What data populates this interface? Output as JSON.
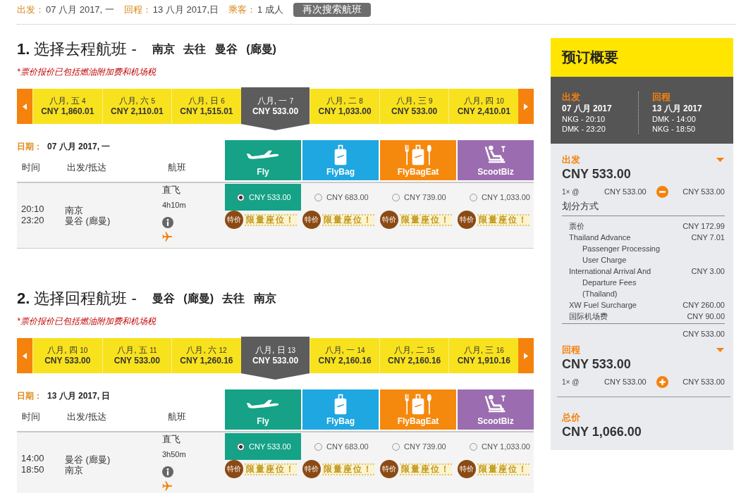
{
  "search_summary": {
    "items": [
      {
        "label": "出发：",
        "value": "07 八月 2017, 一"
      },
      {
        "label": "回程：",
        "value": "13 八月 2017,日"
      },
      {
        "label": "乘客：",
        "value": "1 成人"
      }
    ],
    "button": "再次搜索航班"
  },
  "sections": [
    {
      "title": "**1.** 选择去程航班 -",
      "route": "南京 去往 曼谷 (廊曼)",
      "note": "*票价报价已包括燃油附加费和机场税",
      "date_strip": [
        {
          "label": "八月, 五",
          "day": "4",
          "price": "CNY 1,860.01",
          "selected": false
        },
        {
          "label": "八月, 六",
          "day": "5",
          "price": "CNY 2,110.01",
          "selected": false
        },
        {
          "label": "八月, 日",
          "day": "6",
          "price": "CNY 1,515.01",
          "selected": false
        },
        {
          "label": "八月, 一",
          "day": "7",
          "price": "CNY 533.00",
          "selected": true
        },
        {
          "label": "八月, 二",
          "day": "8",
          "price": "CNY 1,033.00",
          "selected": false
        },
        {
          "label": "八月, 三",
          "day": "9",
          "price": "CNY 533.00",
          "selected": false
        },
        {
          "label": "八月, 四",
          "day": "10",
          "price": "CNY 2,410.01",
          "selected": false
        }
      ],
      "date_label": "日期：",
      "date_value": "07 八月 2017, 一",
      "columns": [
        "时间",
        "出发/抵达",
        "航班"
      ],
      "fare_types": [
        {
          "kind": "fly",
          "name": "Fly",
          "color": "#15a287"
        },
        {
          "kind": "flybag",
          "name": "FlyBag",
          "color": "#1ea7e1"
        },
        {
          "kind": "flybageat",
          "name": "FlyBagEat",
          "color": "#f5890d"
        },
        {
          "kind": "scootbiz",
          "name": "ScootBiz",
          "color": "#9b6db0"
        }
      ],
      "flights": [
        {
          "departure_time": "20:10",
          "arrival_time": "23:20",
          "origin": "南京",
          "destination": "曼谷 (廊曼)",
          "stops": "直飞",
          "duration": "4h10m",
          "fares": [
            {
              "price": "CNY 533.00",
              "selected": true,
              "badge": "特价",
              "tag": "限量座位！"
            },
            {
              "price": "CNY 683.00",
              "selected": false,
              "badge": "特价",
              "tag": "限量座位！"
            },
            {
              "price": "CNY 739.00",
              "selected": false,
              "badge": "特价",
              "tag": "限量座位！"
            },
            {
              "price": "CNY 1,033.00",
              "selected": false,
              "badge": "特价",
              "tag": "限量座位！"
            }
          ]
        }
      ]
    },
    {
      "title": "**2.** 选择回程航班 -",
      "route": "曼谷 (廊曼) 去往 南京",
      "note": "*票价报价已包括燃油附加费和机场税",
      "date_strip": [
        {
          "label": "八月, 四",
          "day": "10",
          "price": "CNY 533.00",
          "selected": false
        },
        {
          "label": "八月, 五",
          "day": "11",
          "price": "CNY 533.00",
          "selected": false
        },
        {
          "label": "八月, 六",
          "day": "12",
          "price": "CNY 1,260.16",
          "selected": false
        },
        {
          "label": "八月, 日",
          "day": "13",
          "price": "CNY 533.00",
          "selected": true
        },
        {
          "label": "八月, 一",
          "day": "14",
          "price": "CNY 2,160.16",
          "selected": false
        },
        {
          "label": "八月, 二",
          "day": "15",
          "price": "CNY 2,160.16",
          "selected": false
        },
        {
          "label": "八月, 三",
          "day": "16",
          "price": "CNY 1,910.16",
          "selected": false
        }
      ],
      "date_label": "日期：",
      "date_value": "13 八月 2017, 日",
      "columns": [
        "时间",
        "出发/抵达",
        "航班"
      ],
      "fare_types": [
        {
          "kind": "fly",
          "name": "Fly",
          "color": "#15a287"
        },
        {
          "kind": "flybag",
          "name": "FlyBag",
          "color": "#1ea7e1"
        },
        {
          "kind": "flybageat",
          "name": "FlyBagEat",
          "color": "#f5890d"
        },
        {
          "kind": "scootbiz",
          "name": "ScootBiz",
          "color": "#9b6db0"
        }
      ],
      "flights": [
        {
          "departure_time": "14:00",
          "arrival_time": "18:50",
          "origin": "曼谷 (廊曼)",
          "destination": "南京",
          "stops": "直飞",
          "duration": "3h50m",
          "fares": [
            {
              "price": "CNY 533.00",
              "selected": true,
              "badge": "特价",
              "tag": "限量座位！"
            },
            {
              "price": "CNY 683.00",
              "selected": false,
              "badge": "特价",
              "tag": "限量座位！"
            },
            {
              "price": "CNY 739.00",
              "selected": false,
              "badge": "特价",
              "tag": "限量座位！"
            },
            {
              "price": "CNY 1,033.00",
              "selected": false,
              "badge": "特价",
              "tag": "限量座位！"
            }
          ]
        }
      ]
    }
  ],
  "booking_summary": {
    "title": "预订概要",
    "legs": [
      {
        "label": "出发",
        "date": "07 八月 2017",
        "from": "NKG - 20:10",
        "to": "DMK - 23:20"
      },
      {
        "label": "回程",
        "date": "13 八月 2017",
        "from": "DMK - 14:00",
        "to": "NKG - 18:50"
      }
    ],
    "sections": [
      {
        "label": "出发",
        "total": "CNY 533.00",
        "quantity": "1× @",
        "unit_price": "CNY 533.00",
        "line_total": "CNY 533.00",
        "expanded": true,
        "breakdown_title": "划分方式",
        "breakdown": [
          {
            "name": "票价",
            "amount": "CNY 172.99"
          },
          {
            "name": "Thailand Advance Passenger Processing User Charge",
            "amount": "CNY 7.01"
          },
          {
            "name": "International Arrival And Departure Fees (Thailand)",
            "amount": "CNY 3.00"
          },
          {
            "name": "XW Fuel Surcharge",
            "amount": "CNY 260.00"
          },
          {
            "name": "国际机场费",
            "amount": "CNY 90.00"
          }
        ],
        "subtotal": "CNY 533.00"
      },
      {
        "label": "回程",
        "total": "CNY 533.00",
        "quantity": "1× @",
        "unit_price": "CNY 533.00",
        "line_total": "CNY 533.00",
        "expanded": false
      }
    ],
    "total_label": "总价",
    "total": "CNY 1,066.00"
  }
}
